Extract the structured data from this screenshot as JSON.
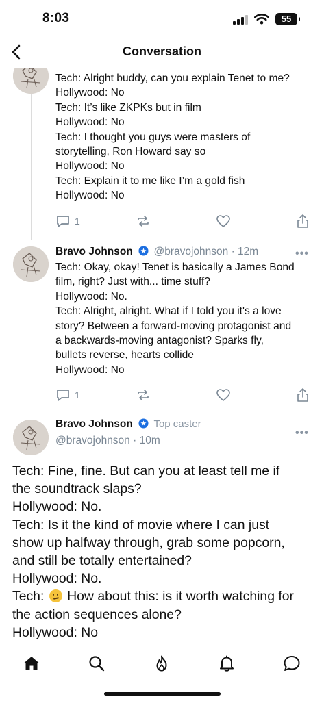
{
  "status_bar": {
    "time": "8:03",
    "battery": "55"
  },
  "nav": {
    "title": "Conversation",
    "back_icon": "chevron-left-icon"
  },
  "parent_cast": {
    "lines": [
      "Tech: Alright buddy, can you explain Tenet to me?",
      "Hollywood: No",
      "Tech: It’s like ZKPKs but in film",
      "Hollywood: No",
      "Tech: I thought you guys were masters of",
      "storytelling, Ron Howard say so",
      "Hollywood: No",
      "Tech: Explain it to me like I’m a gold fish",
      "Hollywood: No"
    ],
    "reply_count": "1"
  },
  "reply_cast": {
    "author_name": "Bravo Johnson",
    "handle": "@bravojohnson",
    "time": "· 12m",
    "more": "•••",
    "lines": [
      "Tech: Okay, okay! Tenet is basically a James Bond",
      "film, right? Just with... time stuff?",
      "Hollywood: No.",
      "Tech: Alright, alright. What if I told you it's a love",
      "story? Between a forward-moving protagonist and",
      "a backwards-moving antagonist? Sparks fly,",
      "bullets reverse, hearts collide",
      "Hollywood: No"
    ],
    "reply_count": "1"
  },
  "main_cast": {
    "author_name": "Bravo Johnson",
    "badge": "Top caster",
    "handle": "@bravojohnson",
    "time": "· 10m",
    "more": "•••",
    "lines": [
      "Tech: Fine, fine. But can you at least tell me if",
      "the soundtrack slaps?",
      "Hollywood: No.",
      "Tech: Is it the kind of movie where I can just",
      "show up halfway through, grab some popcorn,",
      "and still be totally entertained?",
      "Hollywood: No.",
      "How about this: is it worth watching for",
      "the action sequences alone?",
      "Hollywood: No"
    ],
    "emoji_line_prefix": "Tech:",
    "emoji_icon": "neutral-face-emoji-icon"
  },
  "tab_bar": {
    "tabs": [
      "home-icon",
      "search-icon",
      "flame-icon",
      "bell-icon",
      "chat-icon"
    ],
    "active": "home-icon"
  },
  "colors": {
    "accent": "#1d6fe0",
    "muted": "#7a8794",
    "thread_line": "#dcdcdc"
  }
}
